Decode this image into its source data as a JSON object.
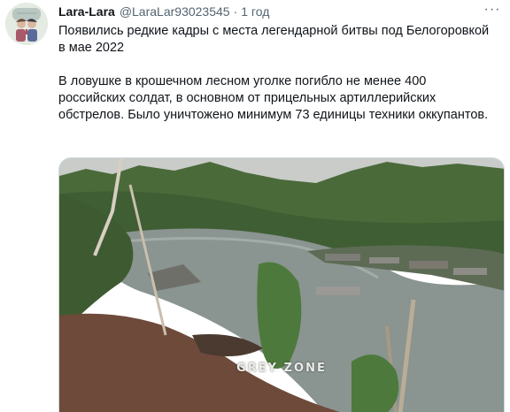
{
  "tweet": {
    "display_name": "Lara-Lara",
    "handle": "@LaraLar93023545",
    "separator": "·",
    "time": "1 год",
    "more": "···",
    "paragraph1": "Появились редкие кадры с места легендарной битвы под Белогоровкой в мае 2022",
    "paragraph2": "В ловушке в крошечном лесном уголке погибло не менее 400 российских солдат, в основном от прицельных артиллерийских обстрелов. Было уничтожено минимум 73 единицы техники оккупантов."
  },
  "media": {
    "watermark": "GREY ZONE",
    "colors": {
      "sky": "#c9ccc9",
      "river": "#8a9490",
      "forest": "#4a6a3a",
      "bank": "#6e4a3a"
    }
  },
  "icons": {
    "more": "more-horizontal-icon",
    "avatar": "avatar-illustration"
  }
}
